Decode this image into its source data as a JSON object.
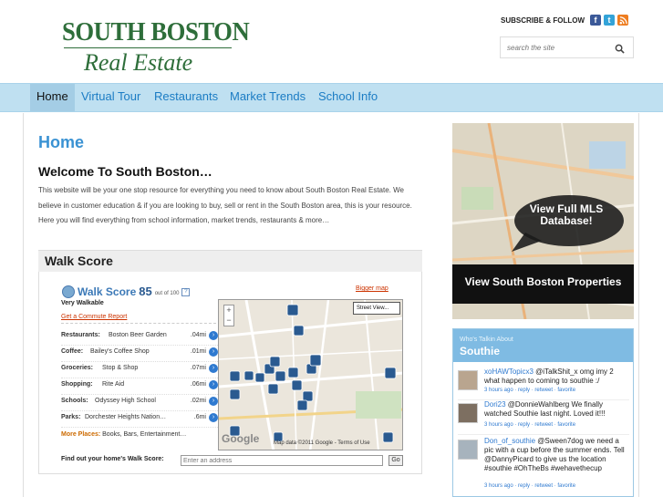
{
  "header": {
    "logo_top": "SOUTH BOSTON",
    "logo_bottom": "Real Estate",
    "subscribe_label": "SUBSCRIBE & FOLLOW",
    "search_placeholder": "search the site"
  },
  "nav": {
    "items": [
      {
        "label": "Home"
      },
      {
        "label": "Virtual Tour"
      },
      {
        "label": "Restaurants"
      },
      {
        "label": "Market Trends"
      },
      {
        "label": "School Info"
      }
    ]
  },
  "main": {
    "title": "Home",
    "welcome_title": "Welcome To South Boston…",
    "intro": "This website will be your one stop resource for everything you need to know about South Boston Real Estate. We believe in customer education & if you are looking to buy, sell or rent in the South Boston area, this is your resource. Here you will find everything from school information, market trends, restaurants & more…",
    "walk_score_heading": "Walk Score"
  },
  "walkscore": {
    "brand": "Walk Score",
    "score": "85",
    "out_of": "out of 100",
    "help": "?",
    "rating": "Very Walkable",
    "bigger_map": "Bigger map",
    "commute_link": "Get a Commute Report",
    "rows": [
      {
        "category": "Restaurants:",
        "name": "Boston Beer Garden",
        "distance": ".04mi"
      },
      {
        "category": "Coffee:",
        "name": "Bailey's Coffee Shop",
        "distance": ".01mi"
      },
      {
        "category": "Groceries:",
        "name": "Stop & Shop",
        "distance": ".07mi"
      },
      {
        "category": "Shopping:",
        "name": "Rite Aid",
        "distance": ".06mi"
      },
      {
        "category": "Schools:",
        "name": "Odyssey High School",
        "distance": ".02mi"
      },
      {
        "category": "Parks:",
        "name": "Dorchester Heights Nation…",
        "distance": ".6mi"
      }
    ],
    "more_label": "More Places:",
    "more_text": "Books, Bars, Entertainment…",
    "find_label": "Find out your home's Walk Score:",
    "address_placeholder": "Enter an address",
    "go_label": "Go",
    "street_view": "Street View...",
    "map_credit": "Map data ©2011 Google - Terms of Use",
    "google_logo": "Google"
  },
  "sidebar": {
    "ad_bubble": "View Full MLS Database!",
    "ad_bar": "View South Boston Properties",
    "twitter_sub": "Who's Talkin About",
    "twitter_title": "Southie",
    "tweets": [
      {
        "user": "xoHAWTopicx3",
        "text": " @iTalkShit_x omg imy 2 what happen to coming to southie :/",
        "meta": "3 hours ago · reply · retweet · favorite"
      },
      {
        "user": "Dori23",
        "text": " @DonnieWahlberg We finally watched Southie last night. Loved it!!!",
        "meta": "3 hours ago · reply · retweet · favorite"
      },
      {
        "user": "Don_of_southie",
        "text": " @Sween7dog we need a pic with a cup before the summer ends. Tell @DannyPicard to give us the location #southie #OhTheBs #wehavethecup",
        "meta": "3 hours ago · reply · retweet · favorite"
      }
    ]
  },
  "colors": {
    "brand_green": "#2e6e3a",
    "nav_bg": "#bfe0f1",
    "link_blue": "#1b7cc4",
    "title_blue": "#3a92d3"
  }
}
